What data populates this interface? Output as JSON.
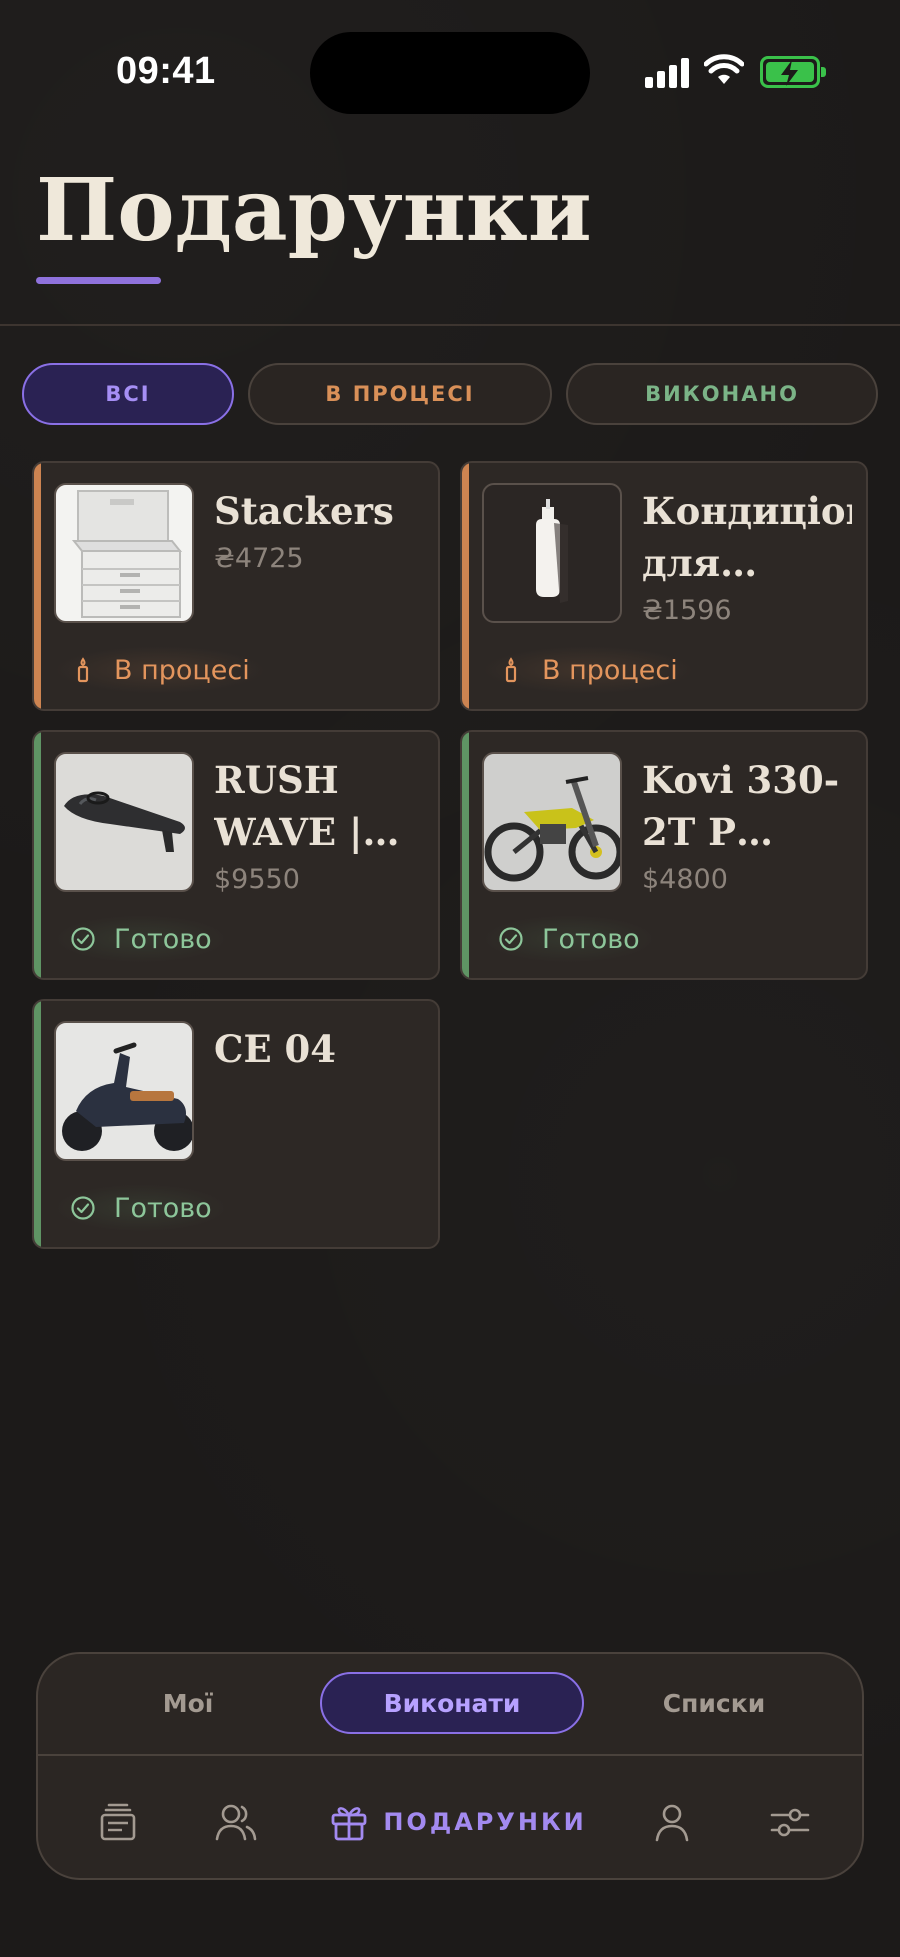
{
  "status_bar": {
    "time": "09:41"
  },
  "header": {
    "title": "Подарунки"
  },
  "filters": [
    {
      "label": "ВСІ",
      "active": true
    },
    {
      "label": "В ПРОЦЕСІ",
      "active": false
    },
    {
      "label": "ВИКОНАНО",
      "active": false
    }
  ],
  "gifts": [
    {
      "name": "Stackers",
      "price": "₴4725",
      "status": "В процесі",
      "state": "progress",
      "image": "jewelry-box-icon"
    },
    {
      "name": "Кондиціонер для…",
      "price": "₴1596",
      "status": "В процесі",
      "state": "progress",
      "image": "conditioner-bottle-icon"
    },
    {
      "name": "RUSH WAVE | E…",
      "price": "$9550",
      "status": "Готово",
      "state": "done",
      "image": "e-surfboard-icon"
    },
    {
      "name": "Kovi 330-2T P…",
      "price": "$4800",
      "status": "Готово",
      "state": "done",
      "image": "dirt-bike-icon"
    },
    {
      "name": "CE 04",
      "price": "",
      "status": "Готово",
      "state": "done",
      "image": "scooter-icon"
    }
  ],
  "bottom_bar": {
    "segments": [
      {
        "label": "Мої",
        "active": false
      },
      {
        "label": "Виконати",
        "active": true
      },
      {
        "label": "Списки",
        "active": false
      }
    ],
    "tabs": {
      "feed": "feed-icon",
      "friends": "friends-icon",
      "gifts_label": "ПОДАРУНКИ",
      "profile": "profile-icon",
      "settings": "sliders-icon"
    }
  },
  "colors": {
    "accent": "#8a70e6",
    "in_progress": "#d99058",
    "done": "#7bb487",
    "background": "#1c1a19"
  }
}
